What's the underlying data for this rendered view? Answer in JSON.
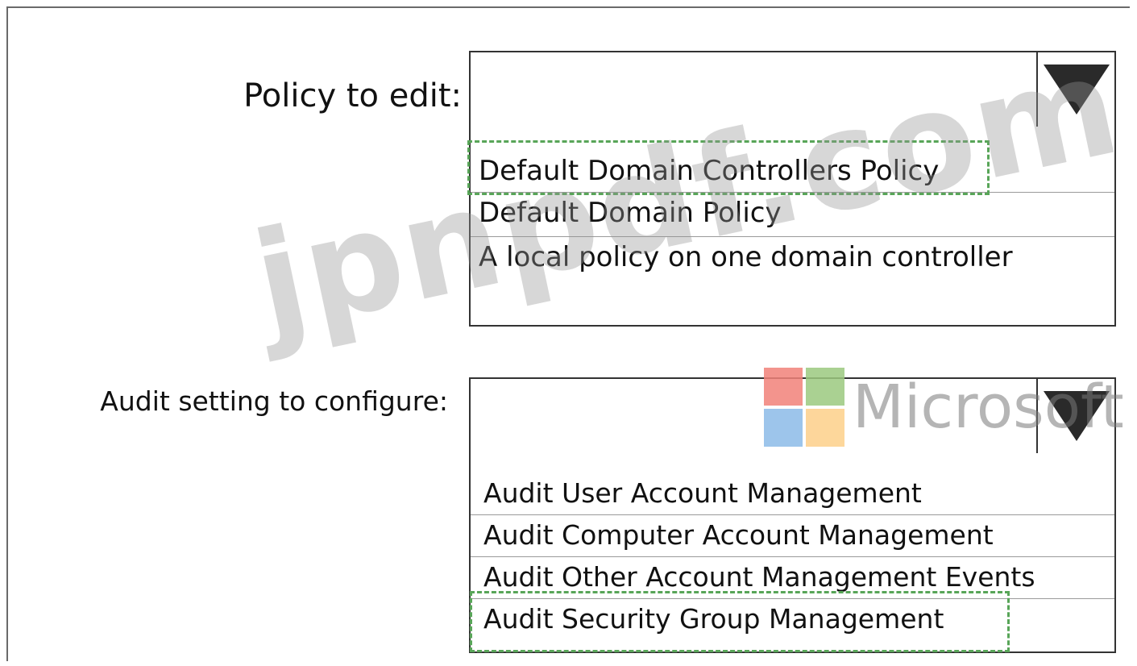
{
  "policy_field": {
    "label": "Policy to edit:",
    "selected": "",
    "options": [
      "Default Domain Controllers Policy",
      "Default Domain Policy",
      "A local policy on one domain controller"
    ],
    "highlighted_option": "Default Domain Controllers Policy",
    "arrow_icon": "triangle-down-icon"
  },
  "audit_field": {
    "label": "Audit setting to configure:",
    "selected": "",
    "options": [
      "Audit User Account Management",
      "Audit Computer Account Management",
      "Audit Other Account Management Events",
      "Audit Security Group Management"
    ],
    "highlighted_option": "Audit Security Group Management",
    "arrow_icon": "triangle-down-icon"
  },
  "watermark": {
    "site_text": "jpnpdf.com",
    "brand_text": "Microsoft"
  },
  "colors": {
    "highlight_dash": "#58a558",
    "border": "#333333"
  }
}
